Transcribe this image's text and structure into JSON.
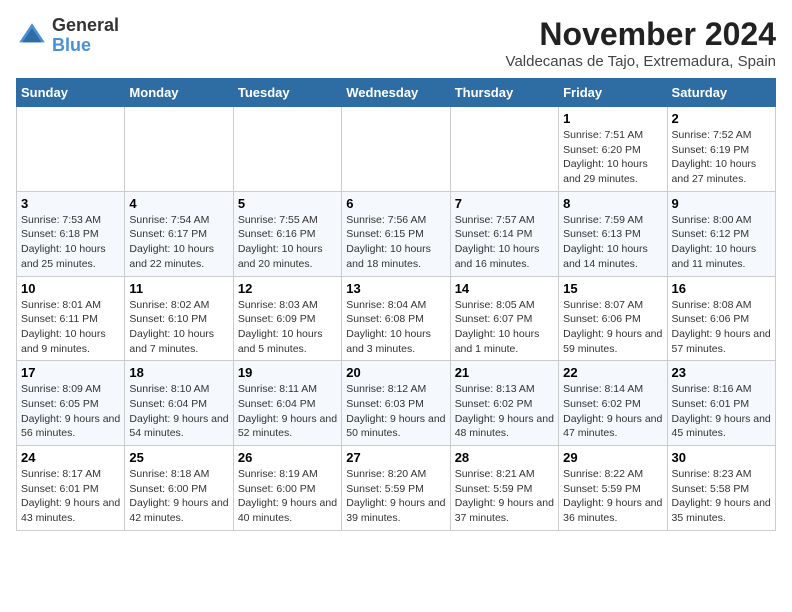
{
  "logo": {
    "general": "General",
    "blue": "Blue"
  },
  "header": {
    "month_year": "November 2024",
    "location": "Valdecanas de Tajo, Extremadura, Spain"
  },
  "days_of_week": [
    "Sunday",
    "Monday",
    "Tuesday",
    "Wednesday",
    "Thursday",
    "Friday",
    "Saturday"
  ],
  "weeks": [
    [
      {
        "day": "",
        "detail": ""
      },
      {
        "day": "",
        "detail": ""
      },
      {
        "day": "",
        "detail": ""
      },
      {
        "day": "",
        "detail": ""
      },
      {
        "day": "",
        "detail": ""
      },
      {
        "day": "1",
        "detail": "Sunrise: 7:51 AM\nSunset: 6:20 PM\nDaylight: 10 hours and 29 minutes."
      },
      {
        "day": "2",
        "detail": "Sunrise: 7:52 AM\nSunset: 6:19 PM\nDaylight: 10 hours and 27 minutes."
      }
    ],
    [
      {
        "day": "3",
        "detail": "Sunrise: 7:53 AM\nSunset: 6:18 PM\nDaylight: 10 hours and 25 minutes."
      },
      {
        "day": "4",
        "detail": "Sunrise: 7:54 AM\nSunset: 6:17 PM\nDaylight: 10 hours and 22 minutes."
      },
      {
        "day": "5",
        "detail": "Sunrise: 7:55 AM\nSunset: 6:16 PM\nDaylight: 10 hours and 20 minutes."
      },
      {
        "day": "6",
        "detail": "Sunrise: 7:56 AM\nSunset: 6:15 PM\nDaylight: 10 hours and 18 minutes."
      },
      {
        "day": "7",
        "detail": "Sunrise: 7:57 AM\nSunset: 6:14 PM\nDaylight: 10 hours and 16 minutes."
      },
      {
        "day": "8",
        "detail": "Sunrise: 7:59 AM\nSunset: 6:13 PM\nDaylight: 10 hours and 14 minutes."
      },
      {
        "day": "9",
        "detail": "Sunrise: 8:00 AM\nSunset: 6:12 PM\nDaylight: 10 hours and 11 minutes."
      }
    ],
    [
      {
        "day": "10",
        "detail": "Sunrise: 8:01 AM\nSunset: 6:11 PM\nDaylight: 10 hours and 9 minutes."
      },
      {
        "day": "11",
        "detail": "Sunrise: 8:02 AM\nSunset: 6:10 PM\nDaylight: 10 hours and 7 minutes."
      },
      {
        "day": "12",
        "detail": "Sunrise: 8:03 AM\nSunset: 6:09 PM\nDaylight: 10 hours and 5 minutes."
      },
      {
        "day": "13",
        "detail": "Sunrise: 8:04 AM\nSunset: 6:08 PM\nDaylight: 10 hours and 3 minutes."
      },
      {
        "day": "14",
        "detail": "Sunrise: 8:05 AM\nSunset: 6:07 PM\nDaylight: 10 hours and 1 minute."
      },
      {
        "day": "15",
        "detail": "Sunrise: 8:07 AM\nSunset: 6:06 PM\nDaylight: 9 hours and 59 minutes."
      },
      {
        "day": "16",
        "detail": "Sunrise: 8:08 AM\nSunset: 6:06 PM\nDaylight: 9 hours and 57 minutes."
      }
    ],
    [
      {
        "day": "17",
        "detail": "Sunrise: 8:09 AM\nSunset: 6:05 PM\nDaylight: 9 hours and 56 minutes."
      },
      {
        "day": "18",
        "detail": "Sunrise: 8:10 AM\nSunset: 6:04 PM\nDaylight: 9 hours and 54 minutes."
      },
      {
        "day": "19",
        "detail": "Sunrise: 8:11 AM\nSunset: 6:04 PM\nDaylight: 9 hours and 52 minutes."
      },
      {
        "day": "20",
        "detail": "Sunrise: 8:12 AM\nSunset: 6:03 PM\nDaylight: 9 hours and 50 minutes."
      },
      {
        "day": "21",
        "detail": "Sunrise: 8:13 AM\nSunset: 6:02 PM\nDaylight: 9 hours and 48 minutes."
      },
      {
        "day": "22",
        "detail": "Sunrise: 8:14 AM\nSunset: 6:02 PM\nDaylight: 9 hours and 47 minutes."
      },
      {
        "day": "23",
        "detail": "Sunrise: 8:16 AM\nSunset: 6:01 PM\nDaylight: 9 hours and 45 minutes."
      }
    ],
    [
      {
        "day": "24",
        "detail": "Sunrise: 8:17 AM\nSunset: 6:01 PM\nDaylight: 9 hours and 43 minutes."
      },
      {
        "day": "25",
        "detail": "Sunrise: 8:18 AM\nSunset: 6:00 PM\nDaylight: 9 hours and 42 minutes."
      },
      {
        "day": "26",
        "detail": "Sunrise: 8:19 AM\nSunset: 6:00 PM\nDaylight: 9 hours and 40 minutes."
      },
      {
        "day": "27",
        "detail": "Sunrise: 8:20 AM\nSunset: 5:59 PM\nDaylight: 9 hours and 39 minutes."
      },
      {
        "day": "28",
        "detail": "Sunrise: 8:21 AM\nSunset: 5:59 PM\nDaylight: 9 hours and 37 minutes."
      },
      {
        "day": "29",
        "detail": "Sunrise: 8:22 AM\nSunset: 5:59 PM\nDaylight: 9 hours and 36 minutes."
      },
      {
        "day": "30",
        "detail": "Sunrise: 8:23 AM\nSunset: 5:58 PM\nDaylight: 9 hours and 35 minutes."
      }
    ]
  ]
}
